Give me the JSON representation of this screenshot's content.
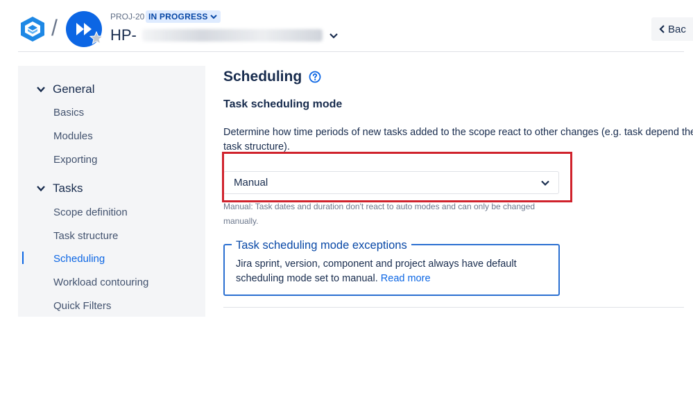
{
  "header": {
    "project_key": "PROJ-20",
    "status": "IN PROGRESS",
    "title_visible_prefix": "HP-",
    "back_label": "Bac"
  },
  "sidebar": {
    "sections": [
      {
        "label": "General",
        "items": [
          "Basics",
          "Modules",
          "Exporting"
        ]
      },
      {
        "label": "Tasks",
        "items": [
          "Scope definition",
          "Task structure",
          "Scheduling",
          "Workload contouring",
          "Quick Filters"
        ]
      }
    ],
    "active_item": "Scheduling"
  },
  "main": {
    "page_title": "Scheduling",
    "section_title": "Task scheduling mode",
    "description": "Determine how time periods of new tasks added to the scope react to other changes (e.g. task depend the task structure).",
    "select_value": "Manual",
    "helper_text": "Manual: Task dates and duration don't react to auto modes and can only be changed manually.",
    "info_panel": {
      "legend": "Task scheduling mode exceptions",
      "body": "Jira sprint, version, component and project always have default scheduling mode set to manual.",
      "link": "Read more"
    }
  },
  "colors": {
    "accent": "#0c66e4",
    "highlight": "#d0222c",
    "sidebar_bg": "#f4f5f7",
    "status_bg": "#deebff"
  }
}
